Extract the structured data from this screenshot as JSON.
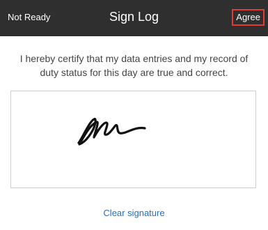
{
  "header": {
    "status": "Not Ready",
    "title": "Sign Log",
    "agree_label": "Agree"
  },
  "certification": {
    "text": "I hereby certify that my data entries and my record of duty status for this day are true and correct."
  },
  "signature": {
    "clear_label": "Clear signature"
  },
  "colors": {
    "header_bg": "#2f2f2f",
    "agree_border": "#e53935",
    "link": "#1f6fc4"
  }
}
